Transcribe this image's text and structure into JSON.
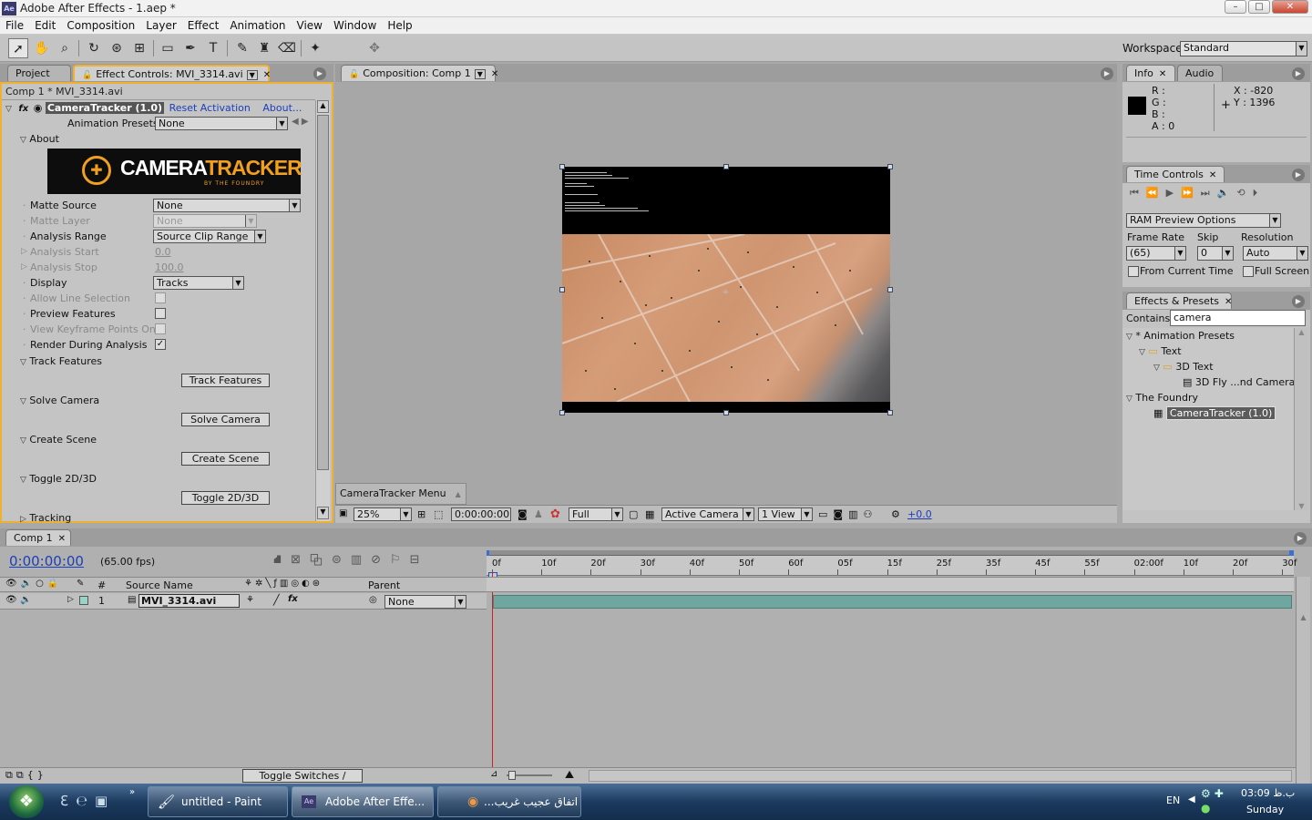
{
  "window": {
    "title": "Adobe After Effects - 1.aep *",
    "icon": "ae-logo-icon",
    "app_badge": "Ae"
  },
  "menu": [
    "File",
    "Edit",
    "Composition",
    "Layer",
    "Effect",
    "Animation",
    "View",
    "Window",
    "Help"
  ],
  "workspace": {
    "label": "Workspace:",
    "value": "Standard"
  },
  "left_panel": {
    "tabs": [
      "Project",
      "Effect Controls: MVI_3314.avi"
    ],
    "header": "Comp 1 * MVI_3314.avi",
    "effect": {
      "name": "CameraTracker (1.0)",
      "reset": "Reset Activation",
      "about": "About..."
    },
    "presets_label": "Animation Presets:",
    "presets_value": "None",
    "about_label": "About",
    "logo": {
      "word1": "CAMERA",
      "word2": "TRACKER",
      "sub": "BY THE FOUNDRY"
    },
    "props": [
      {
        "label": "Matte Source",
        "value": "None"
      },
      {
        "label": "Matte Layer",
        "value": "None"
      },
      {
        "label": "Analysis Range",
        "value": "Source Clip Range"
      },
      {
        "label": "Analysis Start",
        "value": "0.0"
      },
      {
        "label": "Analysis Stop",
        "value": "100.0"
      },
      {
        "label": "Display",
        "value": "Tracks"
      },
      {
        "label": "Allow Line Selection"
      },
      {
        "label": "Preview Features"
      },
      {
        "label": "View Keyframe Points Only"
      },
      {
        "label": "Render During Analysis"
      }
    ],
    "sections": [
      {
        "label": "Track Features",
        "button": "Track Features"
      },
      {
        "label": "Solve Camera",
        "button": "Solve Camera"
      },
      {
        "label": "Create Scene",
        "button": "Create Scene"
      },
      {
        "label": "Toggle 2D/3D",
        "button": "Toggle 2D/3D"
      },
      {
        "label": "Tracking"
      }
    ]
  },
  "comp_panel": {
    "tab": "Composition: Comp 1",
    "menu_label": "CameraTracker Menu",
    "zoom": "25%",
    "timecode": "0:00:00:00",
    "resolution": "Full",
    "camera": "Active Camera",
    "views": "1 View",
    "exposure": "+0.0"
  },
  "info_panel": {
    "tabs": [
      "Info",
      "Audio"
    ],
    "r": "R :",
    "g": "G :",
    "b": "B :",
    "a": "A : 0",
    "x": "X : -820",
    "y": "Y : 1396"
  },
  "time_controls": {
    "tab": "Time Controls",
    "ram": "RAM Preview Options",
    "frame_rate_label": "Frame Rate",
    "frame_rate": "(65)",
    "skip_label": "Skip",
    "skip": "0",
    "resolution_label": "Resolution",
    "resolution": "Auto",
    "from_current": "From Current Time",
    "full_screen": "Full Screen"
  },
  "effects_presets": {
    "tab": "Effects & Presets",
    "contains_label": "Contains:",
    "search": "camera",
    "tree": [
      "* Animation Presets",
      "Text",
      "3D Text",
      "3D Fly ...nd Camera",
      "The Foundry",
      "CameraTracker (1.0)"
    ]
  },
  "timeline": {
    "tab": "Comp 1",
    "timecode": "0:00:00:00",
    "fps": "(65.00 fps)",
    "ruler": [
      "0f",
      "10f",
      "20f",
      "30f",
      "40f",
      "50f",
      "60f",
      "05f",
      "15f",
      "25f",
      "35f",
      "45f",
      "55f",
      "02:00f",
      "10f",
      "20f",
      "30f"
    ],
    "headers": {
      "num": "#",
      "source": "Source Name",
      "parent": "Parent"
    },
    "layer": {
      "num": "1",
      "name": "MVI_3314.avi",
      "parent": "None"
    },
    "toggle": "Toggle Switches / Modes"
  },
  "taskbar": {
    "items": [
      "untitled - Paint",
      "Adobe After Effe...",
      "...اتفاق عجيب غريب"
    ],
    "lang": "EN",
    "time": "03:09 ب.ظ",
    "day": "Sunday"
  },
  "colors": {
    "accent": "#f0b030",
    "panel": "#c3c3c3",
    "layer_bar": "#6fa6a0",
    "playhead": "#d02020",
    "timecode": "#1d3fb8"
  }
}
